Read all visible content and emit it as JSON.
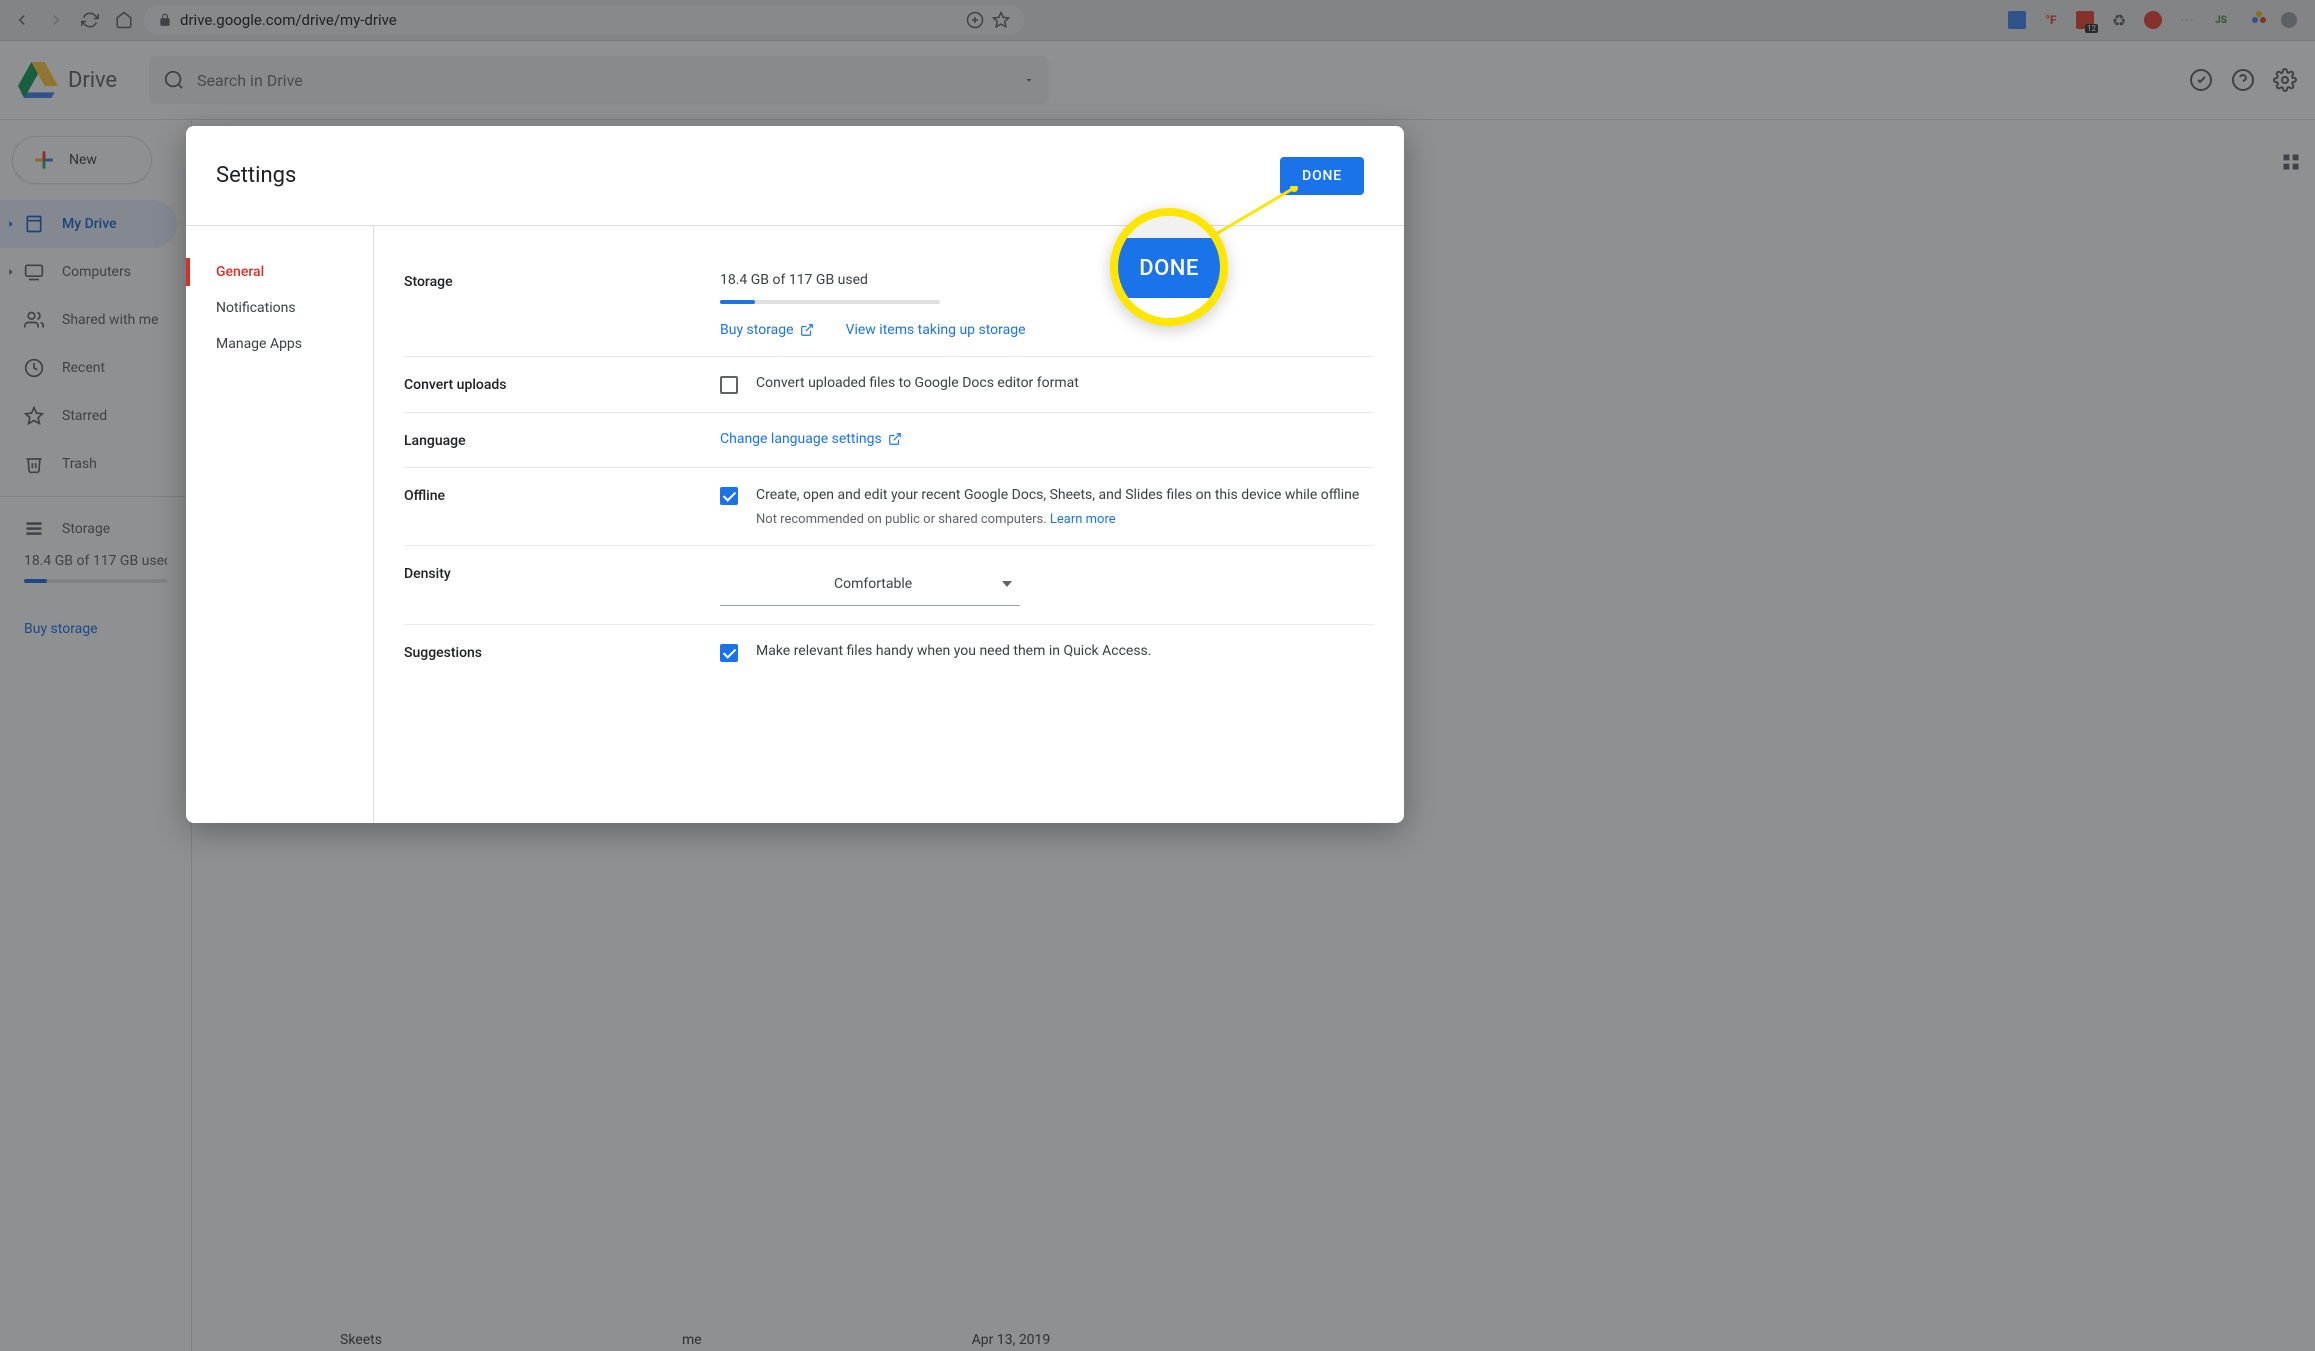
{
  "browser": {
    "url": "drive.google.com/drive/my-drive"
  },
  "header": {
    "app_name": "Drive",
    "search_placeholder": "Search in Drive"
  },
  "sidebar": {
    "new_label": "New",
    "items": [
      {
        "label": "My Drive",
        "active": true
      },
      {
        "label": "Computers"
      },
      {
        "label": "Shared with me"
      },
      {
        "label": "Recent"
      },
      {
        "label": "Starred"
      },
      {
        "label": "Trash"
      }
    ],
    "storage_label": "Storage",
    "storage_used": "18.4 GB of 117 GB used",
    "buy_link": "Buy storage"
  },
  "dialog": {
    "title": "Settings",
    "done_label": "DONE",
    "nav": [
      {
        "label": "General",
        "active": true
      },
      {
        "label": "Notifications"
      },
      {
        "label": "Manage Apps"
      }
    ],
    "sections": {
      "storage": {
        "label": "Storage",
        "value": "18.4 GB of 117 GB used",
        "buy_link": "Buy storage",
        "view_items_link": "View items taking up storage"
      },
      "convert": {
        "label": "Convert uploads",
        "checkbox_label": "Convert uploaded files to Google Docs editor format"
      },
      "language": {
        "label": "Language",
        "link": "Change language settings"
      },
      "offline": {
        "label": "Offline",
        "checkbox_label": "Create, open and edit your recent Google Docs, Sheets, and Slides files on this device while offline",
        "subtext": "Not recommended on public or shared computers. ",
        "learn_more": "Learn more"
      },
      "density": {
        "label": "Density",
        "value": "Comfortable"
      },
      "suggestions": {
        "label": "Suggestions",
        "checkbox_label": "Make relevant files handy when you need them in Quick Access."
      }
    }
  },
  "callout": {
    "label": "DONE"
  },
  "hidden_row": {
    "name": "Skeets",
    "owner": "me",
    "date": "Apr 13, 2019"
  }
}
